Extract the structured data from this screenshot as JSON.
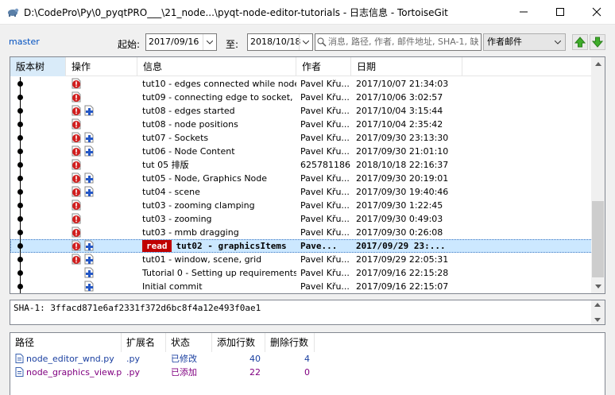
{
  "window": {
    "title": "D:\\CodePro\\Py\\0_pyqtPRO___\\21_node...\\pyqt-node-editor-tutorials - 日志信息 - TortoiseGit"
  },
  "filter": {
    "branch": "master",
    "from_label": "起始:",
    "from_date": "2017/09/16",
    "to_label": "至:",
    "to_date": "2018/10/18",
    "search_placeholder": "消息, 路径, 作者, 邮件地址, SHA-1, 缺",
    "search_field": "作者邮件"
  },
  "log": {
    "columns": [
      "版本树",
      "操作",
      "信息",
      "作者",
      "日期"
    ],
    "selected_badge": "read",
    "rows": [
      {
        "msg": "tut10 - edges connected while node...",
        "author": "Pavel Křu...",
        "date": "2017/10/07 21:34:03",
        "mod": true,
        "add": false
      },
      {
        "msg": "tut09 - connecting edge to socket, ...",
        "author": "Pavel Křu...",
        "date": "2017/10/06 3:02:57",
        "mod": true,
        "add": false
      },
      {
        "msg": "tut08 - edges started",
        "author": "Pavel Křu...",
        "date": "2017/10/04 3:15:44",
        "mod": true,
        "add": true
      },
      {
        "msg": "tut08 - node positions",
        "author": "Pavel Křu...",
        "date": "2017/10/04 2:35:42",
        "mod": true,
        "add": false
      },
      {
        "msg": "tut07 - Sockets",
        "author": "Pavel Křu...",
        "date": "2017/09/30 23:13:30",
        "mod": true,
        "add": true
      },
      {
        "msg": "tut06 - Node Content",
        "author": "Pavel Křu...",
        "date": "2017/09/30 21:01:10",
        "mod": true,
        "add": true
      },
      {
        "msg": "tut 05 排版",
        "author": "625781186",
        "date": "2018/10/18 22:16:37",
        "mod": true,
        "add": false
      },
      {
        "msg": "tut05 - Node, Graphics Node",
        "author": "Pavel Křu...",
        "date": "2017/09/30 20:19:01",
        "mod": true,
        "add": true
      },
      {
        "msg": "tut04 - scene",
        "author": "Pavel Křu...",
        "date": "2017/09/30 19:40:46",
        "mod": true,
        "add": true
      },
      {
        "msg": "tut03 - zooming clamping",
        "author": "Pavel Křu...",
        "date": "2017/09/30 1:22:45",
        "mod": true,
        "add": false
      },
      {
        "msg": "tut03 - zooming",
        "author": "Pavel Křu...",
        "date": "2017/09/30 0:49:03",
        "mod": true,
        "add": false
      },
      {
        "msg": "tut03 - mmb dragging",
        "author": "Pavel Křu...",
        "date": "2017/09/30 0:26:08",
        "mod": true,
        "add": false
      },
      {
        "msg": "tut02 - graphicsItems",
        "author": "Pave...",
        "date": "2017/09/29 23:...",
        "mod": true,
        "add": true,
        "selected": true
      },
      {
        "msg": "tut01 - window, scene, grid",
        "author": "Pavel Křu...",
        "date": "2017/09/29 22:05:31",
        "mod": true,
        "add": true
      },
      {
        "msg": "Tutorial 0 - Setting up requirements",
        "author": "Pavel Křu...",
        "date": "2017/09/16 22:15:28",
        "mod": false,
        "add": true
      },
      {
        "msg": "Initial commit",
        "author": "Pavel Křu...",
        "date": "2017/09/16 22:15:07",
        "mod": false,
        "add": true
      }
    ]
  },
  "sha": {
    "text": "SHA-1: 3ffacd871e6af2331f372d6bc8f4a12e493f0ae1"
  },
  "files": {
    "columns": [
      "路径",
      "扩展名",
      "状态",
      "添加行数",
      "删除行数"
    ],
    "rows": [
      {
        "path": "node_editor_wnd.py",
        "ext": ".py",
        "status": "已修改",
        "added": "40",
        "removed": "4",
        "color": "#1a3fa0"
      },
      {
        "path": "node_graphics_view.py",
        "ext": ".py",
        "status": "已添加",
        "added": "22",
        "removed": "0",
        "color": "#800080"
      }
    ]
  }
}
